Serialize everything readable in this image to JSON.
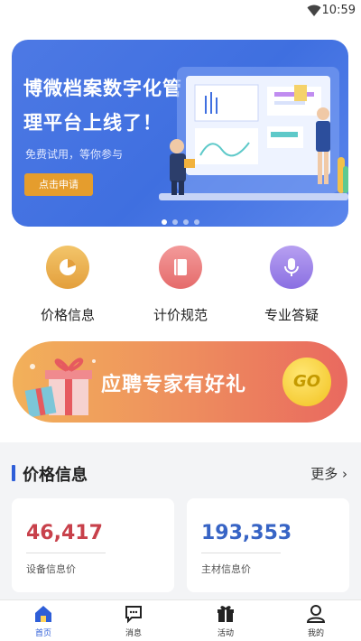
{
  "status_bar": {
    "time": "10:59"
  },
  "banner": {
    "title_line1": "博微档案数字化管",
    "title_line2": "理平台上线了！",
    "subtitle": "免费试用，等你参与",
    "cta_label": "点击申请",
    "carousel_index": 1,
    "carousel_count": 4
  },
  "quick_actions": [
    {
      "label": "价格信息",
      "icon": "pie-chart-icon",
      "color": "#e9a94a"
    },
    {
      "label": "计价规范",
      "icon": "book-icon",
      "color": "#e77676"
    },
    {
      "label": "专业答疑",
      "icon": "microphone-icon",
      "color": "#9b82e8"
    }
  ],
  "promo": {
    "text": "应聘专家有好礼",
    "go_label": "GO"
  },
  "price_section": {
    "title": "价格信息",
    "more_label": "更多 ›",
    "cards": [
      {
        "value": "46,417",
        "caption": "设备信息价",
        "color": "#c8414b"
      },
      {
        "value": "193,353",
        "caption": "主材信息价",
        "color": "#3764c5"
      }
    ]
  },
  "tab_bar": {
    "active": "首页",
    "tabs": [
      {
        "label": "首页",
        "icon": "home-icon"
      },
      {
        "label": "消息",
        "icon": "message-icon"
      },
      {
        "label": "活动",
        "icon": "gift-icon"
      },
      {
        "label": "我的",
        "icon": "user-icon"
      }
    ]
  },
  "colors": {
    "brand_blue": "#2e5ed8",
    "banner_blue": "#4a75e2"
  }
}
